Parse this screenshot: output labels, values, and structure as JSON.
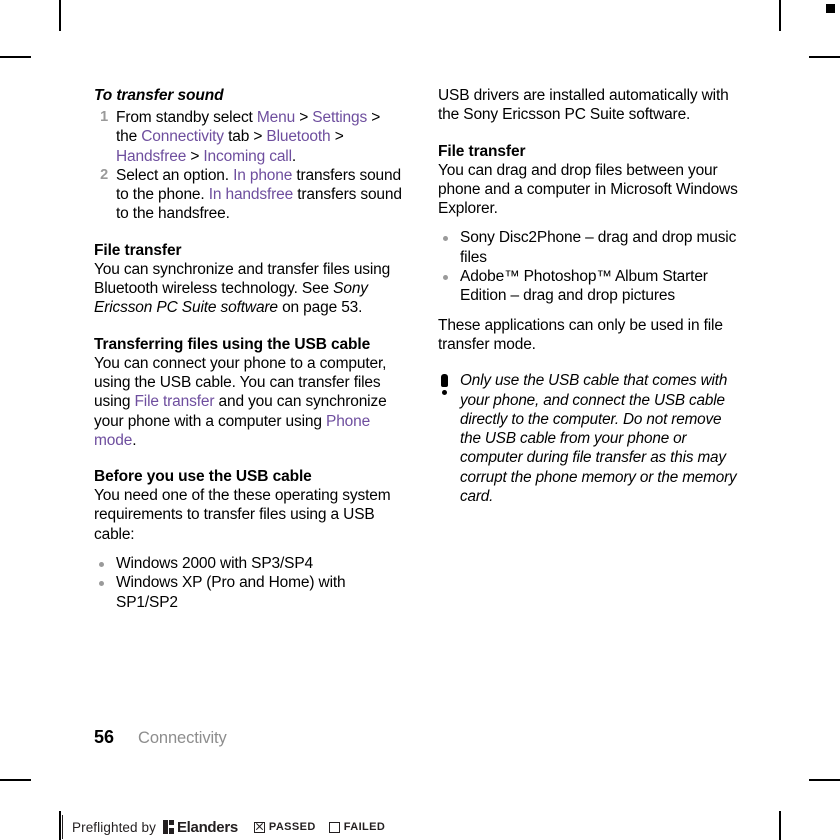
{
  "document": {
    "page_number": "56",
    "chapter": "Connectivity"
  },
  "left_column": {
    "procedure": {
      "title": "To transfer sound",
      "steps": [
        {
          "num": "1",
          "parts": [
            {
              "t": "From standby select ",
              "style": "plain"
            },
            {
              "t": "Menu",
              "style": "purple"
            },
            {
              "t": " > ",
              "style": "plain"
            },
            {
              "t": "Settings",
              "style": "purple"
            },
            {
              "t": " > the ",
              "style": "plain"
            },
            {
              "t": "Connectivity",
              "style": "purple"
            },
            {
              "t": " tab > ",
              "style": "plain"
            },
            {
              "t": "Bluetooth",
              "style": "purple"
            },
            {
              "t": " > ",
              "style": "plain"
            },
            {
              "t": "Handsfree",
              "style": "purple"
            },
            {
              "t": " > ",
              "style": "plain"
            },
            {
              "t": "Incoming call",
              "style": "purple"
            },
            {
              "t": ".",
              "style": "plain"
            }
          ]
        },
        {
          "num": "2",
          "parts": [
            {
              "t": "Select an option. ",
              "style": "plain"
            },
            {
              "t": "In phone",
              "style": "purple"
            },
            {
              "t": " transfers sound to the phone. ",
              "style": "plain"
            },
            {
              "t": "In handsfree",
              "style": "purple"
            },
            {
              "t": " transfers sound to the handsfree.",
              "style": "plain"
            }
          ]
        }
      ]
    },
    "file_transfer": {
      "heading": "File transfer",
      "body_parts": [
        {
          "t": "You can synchronize and transfer files using Bluetooth wireless technology. See ",
          "style": "plain"
        },
        {
          "t": "Sony Ericsson PC Suite software",
          "style": "italic"
        },
        {
          "t": " on page 53.",
          "style": "plain"
        }
      ]
    },
    "usb_cable": {
      "heading": "Transferring files using the USB cable",
      "body_parts": [
        {
          "t": "You can connect your phone to a computer, using the USB cable. You can transfer files using ",
          "style": "plain"
        },
        {
          "t": "File transfer",
          "style": "purple"
        },
        {
          "t": " and you can synchronize your phone with a computer using ",
          "style": "plain"
        },
        {
          "t": "Phone mode",
          "style": "purple"
        },
        {
          "t": ".",
          "style": "plain"
        }
      ]
    },
    "before_usb": {
      "heading": "Before you use the USB cable",
      "body": "You need one of the these operating system requirements to transfer files using a USB cable:",
      "bullets": [
        "Windows 2000 with SP3/SP4",
        "Windows XP (Pro and Home) with SP1/SP2"
      ]
    }
  },
  "right_column": {
    "drivers_body": "USB drivers are installed automatically with the Sony Ericsson PC Suite software.",
    "file_transfer": {
      "heading": "File transfer",
      "body": "You can drag and drop files between your phone and a computer in Microsoft Windows Explorer.",
      "bullets": [
        "Sony Disc2Phone – drag and drop music files",
        "Adobe™ Photoshop™ Album Starter Edition – drag and drop pictures"
      ],
      "closing": "These applications can only be used in file transfer mode."
    },
    "note": {
      "icon": "exclamation-icon",
      "text": "Only use the USB cable that comes with your phone, and connect the USB cable directly to the computer. Do not remove the USB cable from your phone or computer during file transfer as this may corrupt the phone memory or the memory card."
    }
  },
  "preflight": {
    "prefix": "Preflighted by",
    "logo_name": "Elanders",
    "passed_label": "PASSED",
    "failed_label": "FAILED",
    "passed_checked": true,
    "failed_checked": false
  },
  "colors": {
    "link_purple": "#6E4E9E",
    "marker_gray": "#9a9a9a",
    "chapter_gray": "#8d8d8d",
    "ink_black": "#000000"
  }
}
